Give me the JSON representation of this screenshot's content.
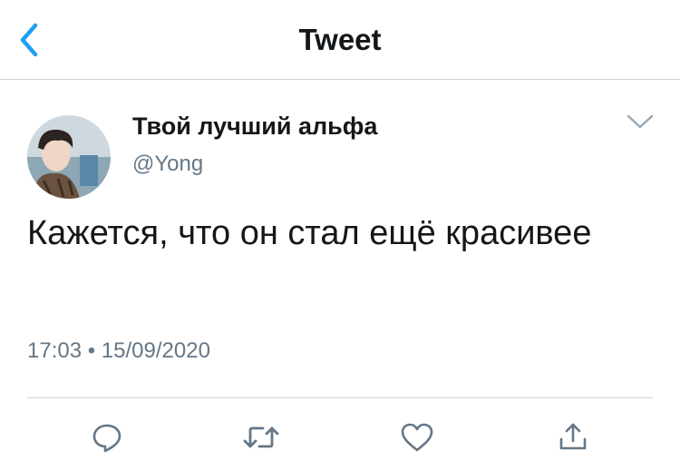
{
  "header": {
    "title": "Tweet"
  },
  "tweet": {
    "author_name": "Твой лучший альфа",
    "author_handle": "@Yong",
    "text": "Кажется, что он стал ещё красивее",
    "timestamp": "17:03 • 15/09/2020"
  },
  "icons": {
    "back": "chevron-left-icon",
    "menu": "chevron-down-icon",
    "reply": "reply-bubble-icon",
    "retweet": "retweet-icon",
    "like": "heart-icon",
    "share": "share-upload-icon"
  },
  "colors": {
    "accent": "#1da1f2",
    "icon_gray": "#657786",
    "text": "#14171a",
    "divider": "#cfd3d6"
  }
}
